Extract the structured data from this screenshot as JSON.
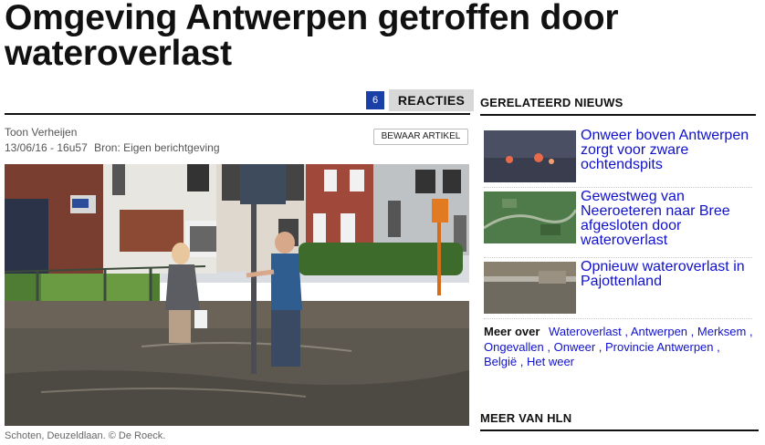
{
  "article": {
    "title": "Omgeving Antwerpen getroffen door wateroverlast",
    "reacties_count": "6",
    "reacties_label": "REACTIES",
    "author": "Toon Verheijen",
    "date": "13/06/16 - 16u57",
    "source": "Bron: Eigen berichtgeving",
    "bewaar_label": "BEWAAR ARTIKEL",
    "photo_caption": "Schoten, Deuzeldlaan. © De Roeck."
  },
  "sidebar": {
    "gerelateerd_heading": "GERELATEERD NIEUWS",
    "related": [
      {
        "title": "Onweer boven Antwerpen zorgt voor zware ochtendspits"
      },
      {
        "title": "Gewestweg van Neeroeteren naar Bree afgesloten door wateroverlast"
      },
      {
        "title": "Opnieuw wateroverlast in Pajottenland"
      }
    ],
    "meer_over_label": "Meer over",
    "tags": [
      "Wateroverlast",
      "Antwerpen",
      "Merksem",
      "Ongevallen",
      "Onweer",
      "Provincie Antwerpen",
      "België",
      "Het weer"
    ],
    "meer_van_heading": "MEER VAN HLN"
  },
  "colors": {
    "link": "#1111cc",
    "badge": "#1a3fa6",
    "reacties_bg": "#d8d8d8"
  }
}
